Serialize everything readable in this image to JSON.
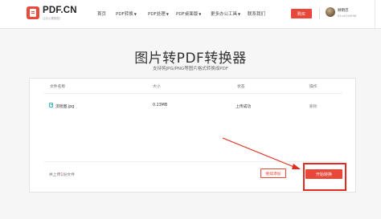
{
  "header": {
    "logo_text": "PDF.CN",
    "logo_sub": "让办公更轻松！",
    "nav": [
      {
        "label": "首页",
        "has_caret": false
      },
      {
        "label": "PDF转换",
        "has_caret": true
      },
      {
        "label": "PDF处理",
        "has_caret": true
      },
      {
        "label": "PDF桌面版",
        "has_caret": true
      },
      {
        "label": "更多办公工具",
        "has_caret": true
      },
      {
        "label": "联系我们",
        "has_caret": false
      }
    ],
    "red_button_label": "购买",
    "user_name": "顾明忠",
    "user_id": "ID:a07d5f96"
  },
  "page": {
    "title": "图片转PDF转换器",
    "subtitle": "支持将JPG/PNG等图片格式转换成PDF"
  },
  "table": {
    "columns": [
      "文件名称",
      "大小",
      "状态",
      "操作"
    ],
    "rows": [
      {
        "name": "流程图.jpg",
        "size": "0.23MB",
        "status": "上传成功",
        "action": "删除"
      }
    ]
  },
  "footer": {
    "count_prefix": "共上传",
    "count_num": "1",
    "count_suffix": "份文件",
    "continue_label": "继续添加",
    "start_label": "开始转换"
  },
  "colors": {
    "accent": "#e8473a",
    "highlight": "#e32a1f",
    "file_icon": "#3cb7c4"
  }
}
